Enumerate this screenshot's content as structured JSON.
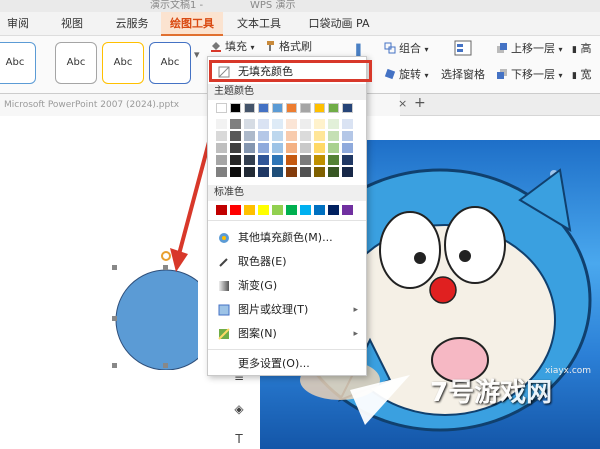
{
  "top_strip": {
    "text_left": "演示文稿1 -",
    "text_right": "WPS 演示"
  },
  "tabs": [
    {
      "label": "审阅",
      "active": false
    },
    {
      "label": "视图",
      "active": false
    },
    {
      "label": "云服务",
      "active": false
    },
    {
      "label": "绘图工具",
      "active": true
    },
    {
      "label": "文本工具",
      "active": false
    },
    {
      "label": "口袋动画 PA",
      "active": false
    }
  ],
  "ribbon": {
    "shape_styles": [
      "Abc",
      "Abc",
      "Abc",
      "Abc"
    ],
    "fill_label": "填充",
    "format_brush_label": "格式刷",
    "group_label": "组合",
    "rotate_label": "旋转",
    "selection_pane_label": "选择窗格",
    "bring_forward_label": "上移一层",
    "send_backward_label": "下移一层",
    "align_label_1": "高",
    "align_label_2": "宽"
  },
  "document_tab": {
    "title": "Microsoft PowerPoint 2007 (2024).pptx",
    "close_symbol": "×",
    "new_symbol": "+"
  },
  "fill_menu": {
    "no_fill": "无填充颜色",
    "theme_colors_label": "主题颜色",
    "standard_colors_label": "标准色",
    "more_fill_colors": "其他填充颜色(M)...",
    "eyedropper": "取色器(E)",
    "gradient": "渐变(G)",
    "picture_texture": "图片或纹理(T)",
    "pattern": "图案(N)",
    "more_settings": "更多设置(O)...",
    "theme_colors_top": [
      "#ffffff",
      "#000000",
      "#44546a",
      "#4472c4",
      "#5b9bd5",
      "#ed7d31",
      "#a5a5a5",
      "#ffc000",
      "#70ad47",
      "#264478"
    ],
    "theme_columns": [
      [
        "#f2f2f2",
        "#d9d9d9",
        "#bfbfbf",
        "#a6a6a6",
        "#808080"
      ],
      [
        "#7f7f7f",
        "#595959",
        "#404040",
        "#262626",
        "#0d0d0d"
      ],
      [
        "#d6dce4",
        "#adb9ca",
        "#8496b0",
        "#333f50",
        "#222a35"
      ],
      [
        "#dae3f3",
        "#b4c7e7",
        "#8faadc",
        "#2f5597",
        "#1f3864"
      ],
      [
        "#deebf7",
        "#bdd7ee",
        "#9dc3e6",
        "#2e75b6",
        "#1f4e79"
      ],
      [
        "#fbe5d6",
        "#f8cbad",
        "#f4b183",
        "#c55a11",
        "#843c0c"
      ],
      [
        "#ededed",
        "#dbdbdb",
        "#c9c9c9",
        "#7b7b7b",
        "#525252"
      ],
      [
        "#fff2cc",
        "#ffe699",
        "#ffd966",
        "#bf9000",
        "#7f6000"
      ],
      [
        "#e2f0d9",
        "#c5e0b4",
        "#a9d18e",
        "#548235",
        "#385723"
      ],
      [
        "#dae3f3",
        "#b4c7e7",
        "#8faadc",
        "#203864",
        "#172848"
      ]
    ],
    "standard_colors": [
      "#c00000",
      "#ff0000",
      "#ffc000",
      "#ffff00",
      "#92d050",
      "#00b050",
      "#00b0f0",
      "#0070c0",
      "#002060",
      "#7030a0"
    ]
  },
  "shape": {
    "fill_color": "#5b9bd5"
  },
  "annotation_color": "#d8382a",
  "watermark": {
    "brand": "7号游戏网",
    "url": "xiayx.com"
  }
}
